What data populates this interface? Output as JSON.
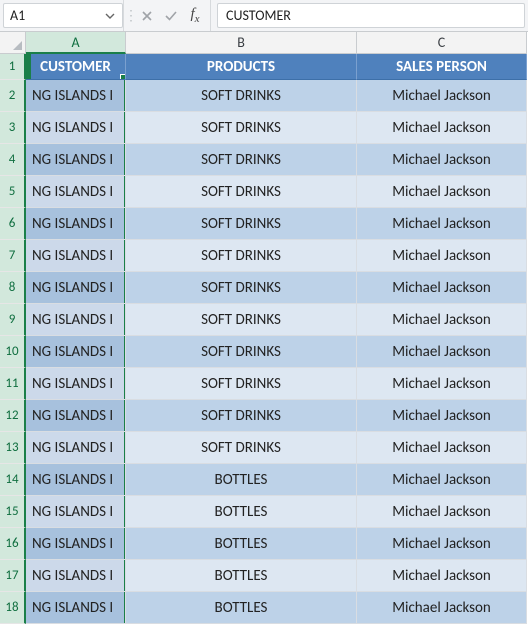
{
  "formula_bar": {
    "name_box_value": "A1",
    "formula_value": "CUSTOMER"
  },
  "columns": {
    "letters": [
      "A",
      "B",
      "C"
    ]
  },
  "table": {
    "headers": {
      "customer": "CUSTOMER",
      "products": "PRODUCTS",
      "sales_person": "SALES PERSON"
    },
    "rows": [
      {
        "n": 2,
        "customer": "NG ISLANDS I",
        "product": "SOFT DRINKS",
        "sales_person": "Michael Jackson"
      },
      {
        "n": 3,
        "customer": "NG ISLANDS I",
        "product": "SOFT DRINKS",
        "sales_person": "Michael Jackson"
      },
      {
        "n": 4,
        "customer": "NG ISLANDS I",
        "product": "SOFT DRINKS",
        "sales_person": "Michael Jackson"
      },
      {
        "n": 5,
        "customer": "NG ISLANDS I",
        "product": "SOFT DRINKS",
        "sales_person": "Michael Jackson"
      },
      {
        "n": 6,
        "customer": "NG ISLANDS I",
        "product": "SOFT DRINKS",
        "sales_person": "Michael Jackson"
      },
      {
        "n": 7,
        "customer": "NG ISLANDS I",
        "product": "SOFT DRINKS",
        "sales_person": "Michael Jackson"
      },
      {
        "n": 8,
        "customer": "NG ISLANDS I",
        "product": "SOFT DRINKS",
        "sales_person": "Michael Jackson"
      },
      {
        "n": 9,
        "customer": "NG ISLANDS I",
        "product": "SOFT DRINKS",
        "sales_person": "Michael Jackson"
      },
      {
        "n": 10,
        "customer": "NG ISLANDS I",
        "product": "SOFT DRINKS",
        "sales_person": "Michael Jackson"
      },
      {
        "n": 11,
        "customer": "NG ISLANDS I",
        "product": "SOFT DRINKS",
        "sales_person": "Michael Jackson"
      },
      {
        "n": 12,
        "customer": "NG ISLANDS I",
        "product": "SOFT DRINKS",
        "sales_person": "Michael Jackson"
      },
      {
        "n": 13,
        "customer": "NG ISLANDS I",
        "product": "SOFT DRINKS",
        "sales_person": "Michael Jackson"
      },
      {
        "n": 14,
        "customer": "NG ISLANDS I",
        "product": "BOTTLES",
        "sales_person": "Michael Jackson"
      },
      {
        "n": 15,
        "customer": "NG ISLANDS I",
        "product": "BOTTLES",
        "sales_person": "Michael Jackson"
      },
      {
        "n": 16,
        "customer": "NG ISLANDS I",
        "product": "BOTTLES",
        "sales_person": "Michael Jackson"
      },
      {
        "n": 17,
        "customer": "NG ISLANDS I",
        "product": "BOTTLES",
        "sales_person": "Michael Jackson"
      },
      {
        "n": 18,
        "customer": "NG ISLANDS I",
        "product": "BOTTLES",
        "sales_person": "Michael Jackson"
      }
    ]
  },
  "selection": {
    "active_cell": "A1",
    "selected_column": "A"
  }
}
